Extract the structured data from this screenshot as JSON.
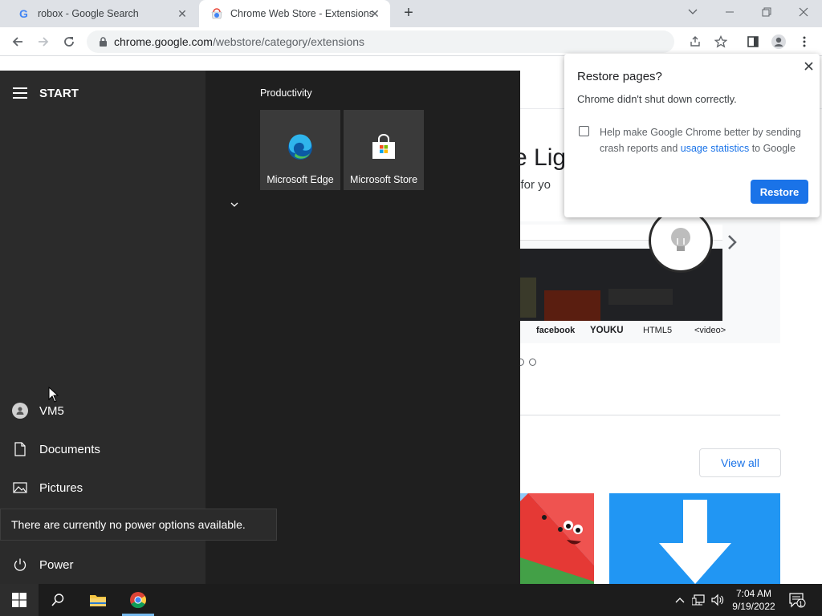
{
  "browser": {
    "tabs": [
      {
        "title": "robox - Google Search",
        "favicon": "google-g-icon"
      },
      {
        "title": "Chrome Web Store - Extensions",
        "favicon": "chrome-webstore-icon"
      }
    ],
    "url": {
      "host": "chrome.google.com",
      "path": "/webstore/category/extensions"
    },
    "colors": {
      "tabstrip": "#dee1e6",
      "accent": "#1a73e8"
    }
  },
  "webpage": {
    "hero_title": "e Lig",
    "hero_sub": "n for yo",
    "logos": [
      "facebook",
      "YOUKU",
      "HTML5",
      "<video>"
    ],
    "view_all": "View all"
  },
  "start_menu": {
    "title": "START",
    "group_label": "Productivity",
    "tiles": [
      {
        "label": "Microsoft Edge",
        "icon": "edge-icon"
      },
      {
        "label": "Microsoft Store",
        "icon": "store-icon"
      }
    ],
    "user": "VM5",
    "documents": "Documents",
    "pictures": "Pictures",
    "power": "Power",
    "power_tooltip": "There are currently no power options available."
  },
  "restore_dialog": {
    "title": "Restore pages?",
    "message": "Chrome didn't shut down correctly.",
    "checkbox_text_1": "Help make Google Chrome better by sending crash reports and ",
    "checkbox_link": "usage statistics",
    "checkbox_text_2": " to Google",
    "button": "Restore"
  },
  "taskbar": {
    "time": "7:04 AM",
    "date": "9/19/2022",
    "notification_count": "1"
  }
}
